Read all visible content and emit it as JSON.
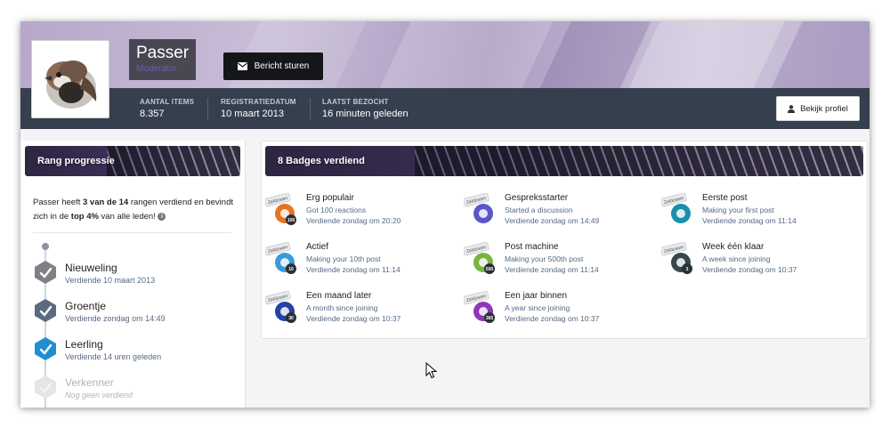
{
  "profile": {
    "name": "Passer",
    "role": "Moderator",
    "message_button": "Bericht sturen",
    "view_profile_button": "Bekijk profiel",
    "stats": [
      {
        "label": "AANTAL ITEMS",
        "value": "8.357"
      },
      {
        "label": "REGISTRATIEDATUM",
        "value": "10 maart 2013"
      },
      {
        "label": "LAATST BEZOCHT",
        "value": "16 minuten geleden"
      }
    ]
  },
  "rank_panel": {
    "title": "Rang progressie",
    "summary_pre": "Passer heeft ",
    "summary_bold1": "3 van de 14",
    "summary_mid": " rangen verdiend en bevindt zich in de ",
    "summary_bold2": "top 4%",
    "summary_post": " van alle leden!",
    "ranks": [
      {
        "name": "Nieuweling",
        "date": "Verdiende 10 maart 2013",
        "color": "#7d8186",
        "earned": true
      },
      {
        "name": "Groentje",
        "date": "Verdiende zondag om 14:49",
        "color": "#5c6a80",
        "earned": true
      },
      {
        "name": "Leerling",
        "date": "Verdiende 14 uren geleden",
        "color": "#1f8fcf",
        "earned": true
      },
      {
        "name": "Verkenner",
        "date": "Nog geen verdiend",
        "color": "#e4e5e8",
        "earned": false
      }
    ]
  },
  "badges_panel": {
    "title": "8 Badges verdiend",
    "rare_label": "Zeldzaam",
    "badges": [
      {
        "title": "Erg populair",
        "desc": "Got 100 reactions",
        "date": "Verdiende zondag om 20:20",
        "color": "#e8731f",
        "num": "100"
      },
      {
        "title": "Gespreksstarter",
        "desc": "Started a discussion",
        "date": "Verdiende zondag om 14:49",
        "color": "#5a56c8",
        "num": ""
      },
      {
        "title": "Eerste post",
        "desc": "Making your first post",
        "date": "Verdiende zondag om 11:14",
        "color": "#1a8fa8",
        "num": ""
      },
      {
        "title": "Actief",
        "desc": "Making your 10th post",
        "date": "Verdiende zondag om 11:14",
        "color": "#3a9bdc",
        "num": "10"
      },
      {
        "title": "Post machine",
        "desc": "Making your 500th post",
        "date": "Verdiende zondag om 11:14",
        "color": "#7cb342",
        "num": "500"
      },
      {
        "title": "Week één klaar",
        "desc": "A week since joining",
        "date": "Verdiende zondag om 10:37",
        "color": "#37474f",
        "num": "3"
      },
      {
        "title": "Een maand later",
        "desc": "A month since joining",
        "date": "Verdiende zondag om 10:37",
        "color": "#2443a6",
        "num": "30"
      },
      {
        "title": "Een jaar binnen",
        "desc": "A year since joining",
        "date": "Verdiende zondag om 10:37",
        "color": "#8e36b8",
        "num": "365"
      }
    ]
  }
}
